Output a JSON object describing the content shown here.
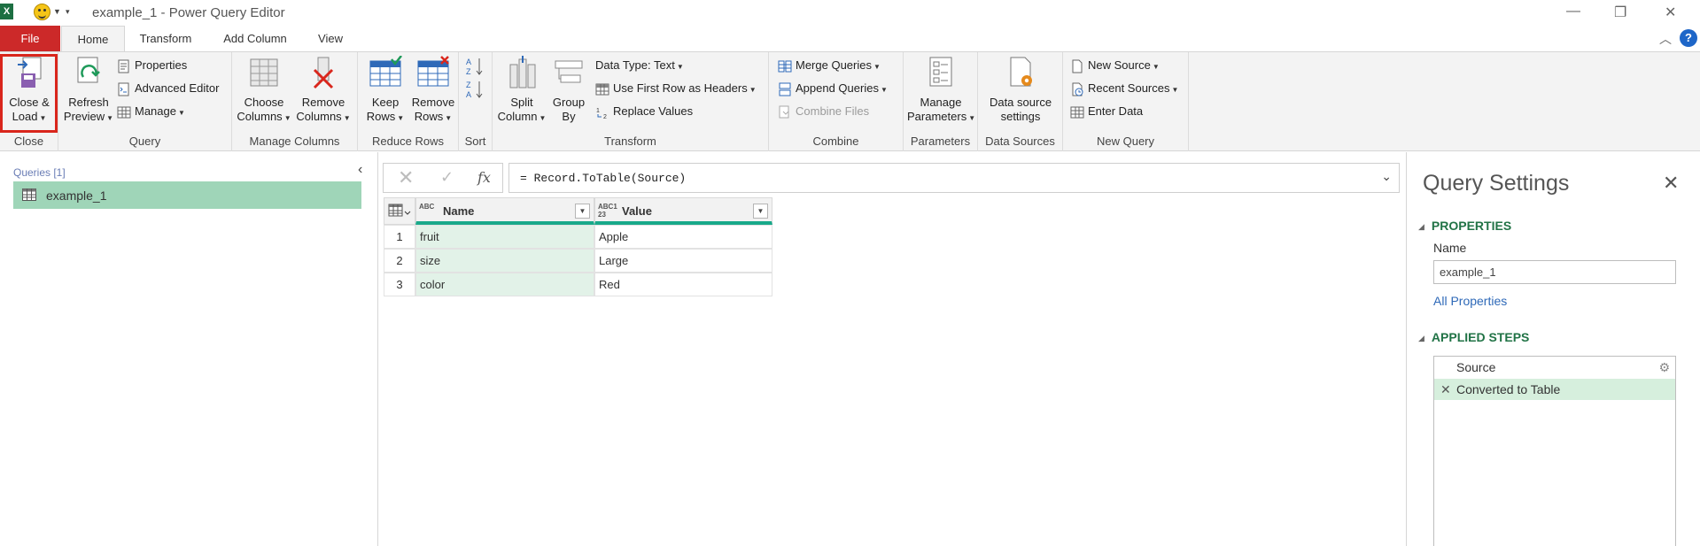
{
  "window": {
    "title": "example_1 - Power Query Editor",
    "app_badge": "X"
  },
  "tabs": {
    "file": "File",
    "items": [
      "Home",
      "Transform",
      "Add Column",
      "View"
    ],
    "active": "Home"
  },
  "help": "?",
  "ribbon": {
    "close": {
      "close_load": [
        "Close &",
        "Load"
      ],
      "label": "Close"
    },
    "query": {
      "refresh": [
        "Refresh",
        "Preview"
      ],
      "properties": "Properties",
      "advanced_editor": "Advanced Editor",
      "manage": "Manage",
      "label": "Query"
    },
    "manage_columns": {
      "choose": [
        "Choose",
        "Columns"
      ],
      "remove": [
        "Remove",
        "Columns"
      ],
      "label": "Manage Columns"
    },
    "reduce_rows": {
      "keep": [
        "Keep",
        "Rows"
      ],
      "remove": [
        "Remove",
        "Rows"
      ],
      "label": "Reduce Rows"
    },
    "sort": {
      "label": "Sort"
    },
    "transform": {
      "split": [
        "Split",
        "Column"
      ],
      "group": [
        "Group",
        "By"
      ],
      "data_type": "Data Type: Text",
      "first_row": "Use First Row as Headers",
      "replace": "Replace Values",
      "label": "Transform"
    },
    "combine": {
      "merge": "Merge Queries",
      "append": "Append Queries",
      "combine_files": "Combine Files",
      "label": "Combine"
    },
    "parameters": {
      "manage": [
        "Manage",
        "Parameters"
      ],
      "label": "Parameters"
    },
    "data_sources": {
      "settings": [
        "Data source",
        "settings"
      ],
      "label": "Data Sources"
    },
    "new_query": {
      "new_source": "New Source",
      "recent_sources": "Recent Sources",
      "enter_data": "Enter Data",
      "label": "New Query"
    }
  },
  "queries": {
    "header": "Queries [1]",
    "items": [
      "example_1"
    ]
  },
  "formula": {
    "text": "= Record.ToTable(Source)",
    "fx": "fx"
  },
  "table": {
    "columns": [
      {
        "name": "Name",
        "type": "ABC"
      },
      {
        "name": "Value",
        "type": "ABC123"
      }
    ],
    "rows": [
      {
        "num": "1",
        "name": "fruit",
        "value": "Apple"
      },
      {
        "num": "2",
        "name": "size",
        "value": "Large"
      },
      {
        "num": "3",
        "name": "color",
        "value": "Red"
      }
    ]
  },
  "settings": {
    "title": "Query Settings",
    "properties_title": "PROPERTIES",
    "name_label": "Name",
    "name_value": "example_1",
    "all_properties": "All Properties",
    "steps_title": "APPLIED STEPS",
    "steps": [
      "Source",
      "Converted to Table"
    ]
  },
  "colors": {
    "file_tab": "#cc2929",
    "accent_green": "#217346",
    "selected_query": "#9fd5b8",
    "column_bar": "#19a98a",
    "highlight": "#d9261c"
  }
}
